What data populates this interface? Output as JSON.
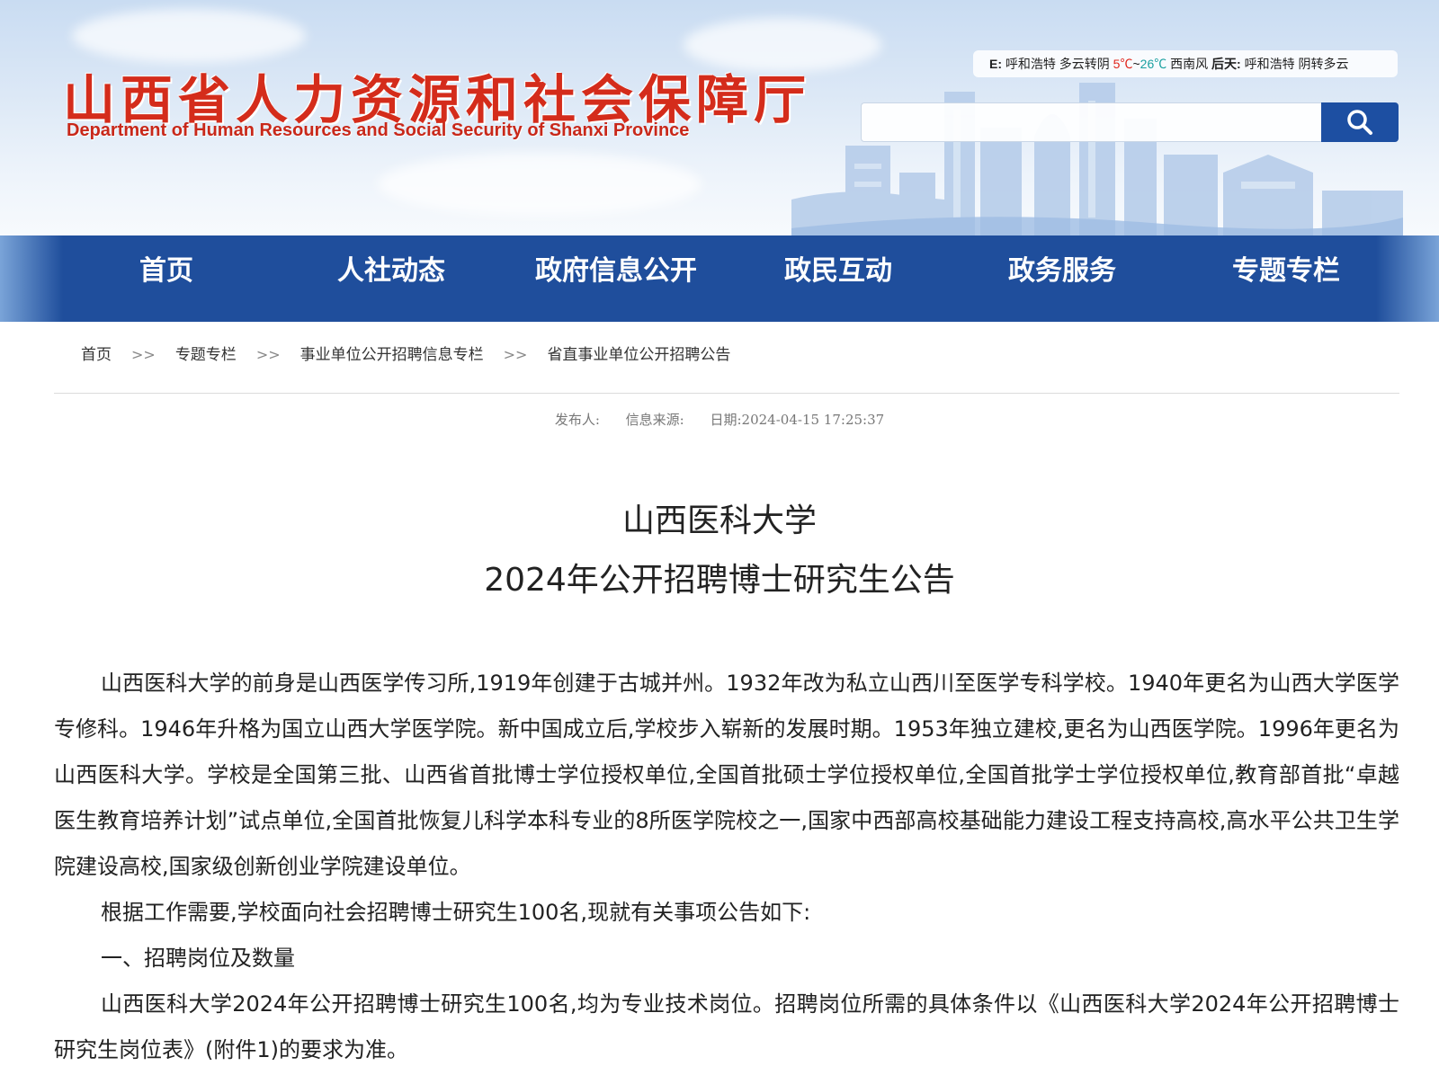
{
  "header": {
    "title_cn": "山西省人力资源和社会保障厅",
    "title_en": "Department of Human Resources and Social Security of Shanxi Province",
    "weather": {
      "prefix": "E:",
      "city1": "呼和浩特",
      "cond1": "多云转阴",
      "low": "5℃",
      "tilde": "~",
      "high": "26℃",
      "wind": "西南风",
      "label2": "后天:",
      "city2": "呼和浩特",
      "cond2": "阴转多云"
    },
    "search": {
      "placeholder": ""
    }
  },
  "nav": {
    "items": [
      "首页",
      "人社动态",
      "政府信息公开",
      "政民互动",
      "政务服务",
      "专题专栏"
    ]
  },
  "breadcrumb": {
    "items": [
      "首页",
      "专题专栏",
      "事业单位公开招聘信息专栏",
      "省直事业单位公开招聘公告"
    ],
    "separator": ">>"
  },
  "article": {
    "meta": {
      "publisher": "发布人:",
      "source": "信息来源:",
      "date": "日期:2024-04-15 17:25:37"
    },
    "title_line1": "山西医科大学",
    "title_line2": "2024年公开招聘博士研究生公告",
    "paragraphs": [
      "山西医科大学的前身是山西医学传习所,1919年创建于古城并州。1932年改为私立山西川至医学专科学校。1940年更名为山西大学医学专修科。1946年升格为国立山西大学医学院。新中国成立后,学校步入崭新的发展时期。1953年独立建校,更名为山西医学院。1996年更名为山西医科大学。学校是全国第三批、山西省首批博士学位授权单位,全国首批硕士学位授权单位,全国首批学士学位授权单位,教育部首批“卓越医生教育培养计划”试点单位,全国首批恢复儿科学本科专业的8所医学院校之一,国家中西部高校基础能力建设工程支持高校,高水平公共卫生学院建设高校,国家级创新创业学院建设单位。",
      "根据工作需要,学校面向社会招聘博士研究生100名,现就有关事项公告如下:",
      "一、招聘岗位及数量",
      "山西医科大学2024年公开招聘博士研究生100名,均为专业技术岗位。招聘岗位所需的具体条件以《山西医科大学2024年公开招聘博士研究生岗位表》(附件1)的要求为准。"
    ]
  }
}
